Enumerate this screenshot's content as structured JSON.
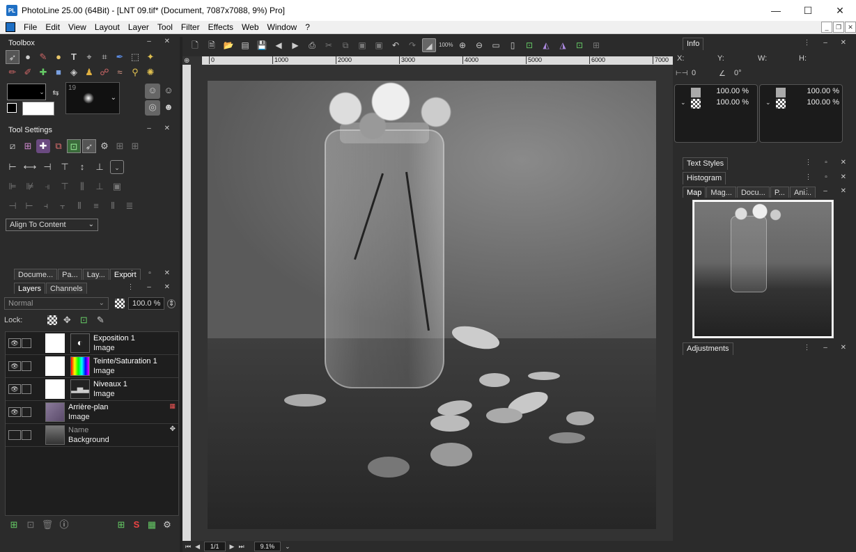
{
  "window": {
    "title": "PhotoLine 25.00 (64Bit) - [LNT 09.tif* (Document, 7087x7088, 9%) Pro]",
    "logo": "PL",
    "minimize": "—",
    "maximize": "☐",
    "close": "✕"
  },
  "menu": [
    "File",
    "Edit",
    "View",
    "Layout",
    "Layer",
    "Tool",
    "Filter",
    "Effects",
    "Web",
    "Window",
    "?"
  ],
  "toolbox": {
    "title": "Toolbox",
    "brush_size": "19"
  },
  "tool_settings": {
    "title": "Tool Settings",
    "align_mode": "Align To Content"
  },
  "bottom_tabs": [
    "Docume...",
    "Pa...",
    "Lay...",
    "Export"
  ],
  "layers_panel": {
    "tabs": [
      "Layers",
      "Channels"
    ],
    "blend_mode": "Normal",
    "opacity": "100.0 %",
    "lock_label": "Lock:",
    "layers": [
      {
        "name": "Exposition 1",
        "type": "Image"
      },
      {
        "name": "Teinte/Saturation 1",
        "type": "Image"
      },
      {
        "name": "Niveaux 1",
        "type": "Image"
      },
      {
        "name": "Arrière-plan",
        "type": "Image"
      },
      {
        "name": "Name",
        "type": "Background"
      }
    ]
  },
  "document": {
    "ruler_h": [
      "0",
      "1000",
      "2000",
      "3000",
      "4000",
      "5000",
      "6000",
      "7000"
    ],
    "page": "1/1",
    "zoom": "9.1%"
  },
  "info_panel": {
    "title": "Info",
    "x_label": "X:",
    "y_label": "Y:",
    "w_label": "W:",
    "h_label": "H:",
    "width_value": "0",
    "angle_value": "0°",
    "left_values": [
      "100.00 %",
      "100.00 %"
    ],
    "right_values": [
      "100.00 %",
      "100.00 %"
    ]
  },
  "right_panels": {
    "text_styles": "Text Styles",
    "histogram": "Histogram",
    "nav_tabs": [
      "Map",
      "Mag...",
      "Docu...",
      "P...",
      "Ani..."
    ],
    "adjustments": "Adjustments"
  }
}
